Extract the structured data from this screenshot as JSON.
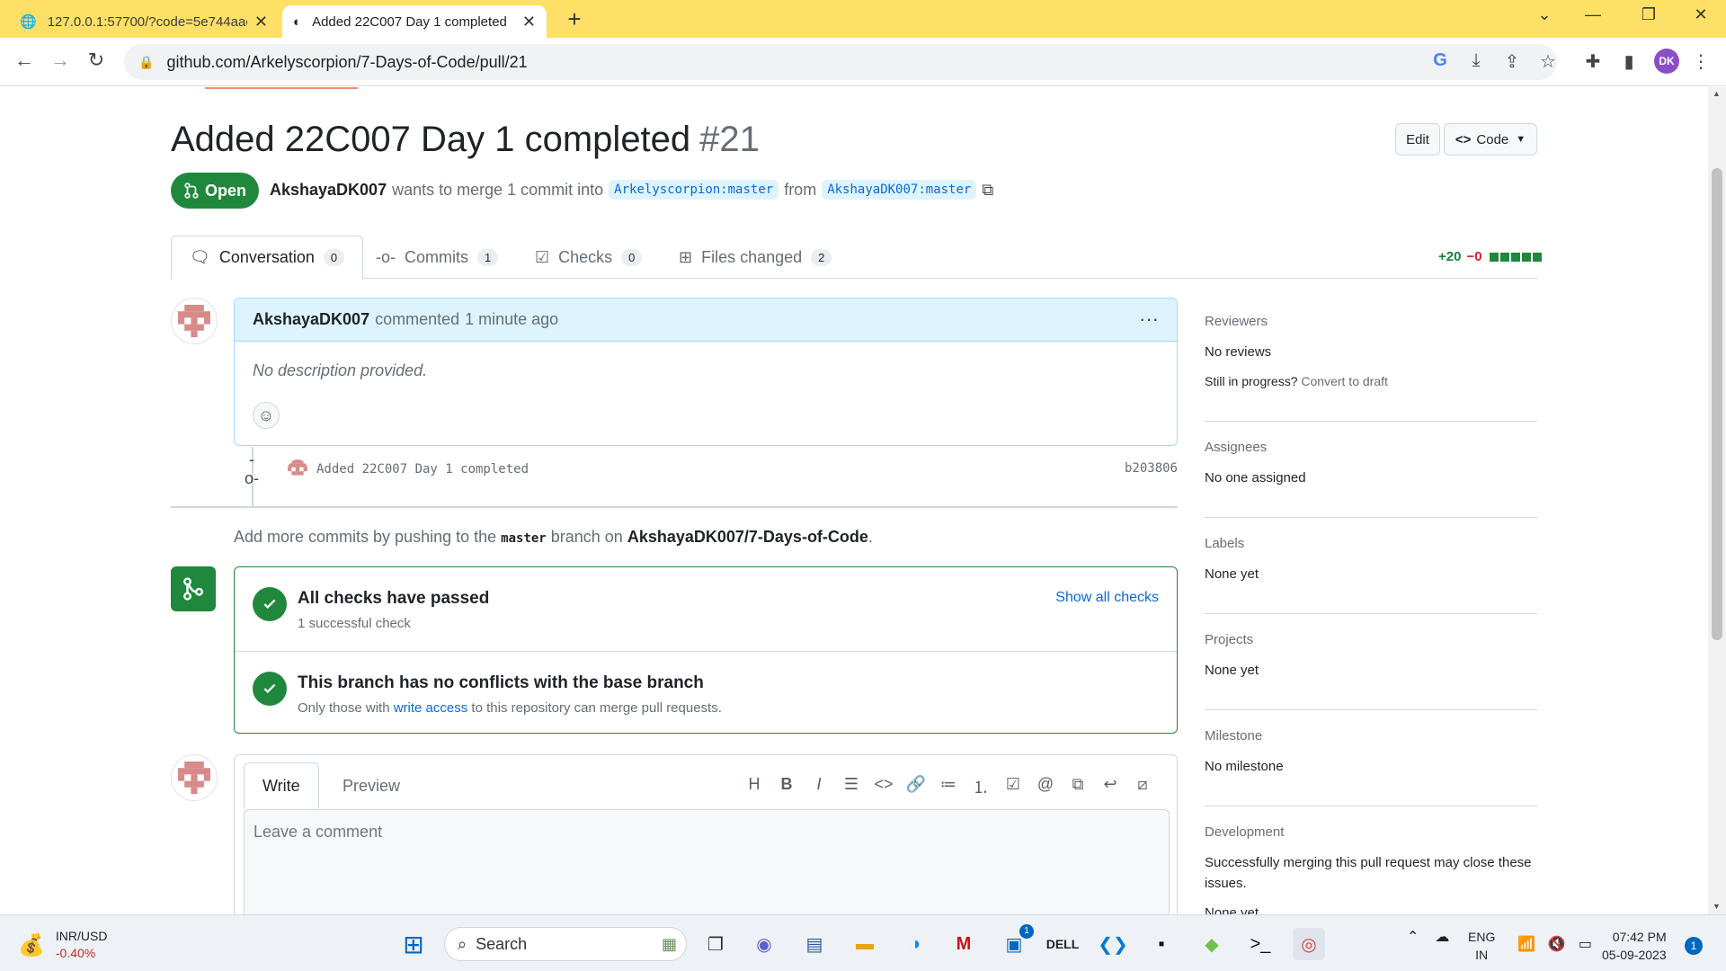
{
  "browser": {
    "tabs": [
      {
        "title": "127.0.0.1:57700/?code=5e744aac",
        "active": false
      },
      {
        "title": "Added 22C007 Day 1 completed",
        "active": true
      }
    ],
    "url": "github.com/Arkelyscorpion/7-Days-of-Code/pull/21",
    "profile_initials": "DK"
  },
  "pr": {
    "title": "Added 22C007 Day 1 completed",
    "number": "#21",
    "edit_label": "Edit",
    "code_label": "Code",
    "state": "Open",
    "author": "AkshayaDK007",
    "merge_text": "wants to merge 1 commit into",
    "base_branch": "Arkelyscorpion:master",
    "from_text": "from",
    "head_branch": "AkshayaDK007:master"
  },
  "tabs": [
    {
      "label": "Conversation",
      "count": "0"
    },
    {
      "label": "Commits",
      "count": "1"
    },
    {
      "label": "Checks",
      "count": "0"
    },
    {
      "label": "Files changed",
      "count": "2"
    }
  ],
  "diffstat": {
    "additions": "+20",
    "deletions": "−0"
  },
  "comment": {
    "author": "AkshayaDK007",
    "action": "commented",
    "time": "1 minute ago",
    "body": "No description provided."
  },
  "commit": {
    "message": "Added 22C007 Day 1 completed",
    "sha": "b203806"
  },
  "hint": {
    "prefix": "Add more commits by pushing to the",
    "branch": "master",
    "middle": "branch on",
    "repo": "AkshayaDK007/7-Days-of-Code",
    "suffix": "."
  },
  "checks": {
    "title": "All checks have passed",
    "subtitle": "1 successful check",
    "show_all": "Show all checks",
    "conflict_title": "This branch has no conflicts with the base branch",
    "conflict_prefix": "Only those with",
    "conflict_link": "write access",
    "conflict_suffix": "to this repository can merge pull requests."
  },
  "composer": {
    "write_tab": "Write",
    "preview_tab": "Preview",
    "placeholder": "Leave a comment"
  },
  "sidebar": {
    "reviewers_label": "Reviewers",
    "reviewers_value": "No reviews",
    "draft_prefix": "Still in progress?",
    "draft_link": "Convert to draft",
    "assignees_label": "Assignees",
    "assignees_value": "No one assigned",
    "labels_label": "Labels",
    "labels_value": "None yet",
    "projects_label": "Projects",
    "projects_value": "None yet",
    "milestone_label": "Milestone",
    "milestone_value": "No milestone",
    "development_label": "Development",
    "development_text": "Successfully merging this pull request may close these issues.",
    "development_value": "None yet"
  },
  "taskbar": {
    "ticker": "INR/USD",
    "ticker_change": "-0.40%",
    "search_label": "Search",
    "store_badge": "1",
    "lang": "ENG",
    "region": "IN",
    "time": "07:42 PM",
    "date": "05-09-2023",
    "notifications": "1"
  },
  "colors": {
    "open_green": "#1f883d",
    "link_blue": "#0969da",
    "chrome_tabbar": "#fde065"
  }
}
